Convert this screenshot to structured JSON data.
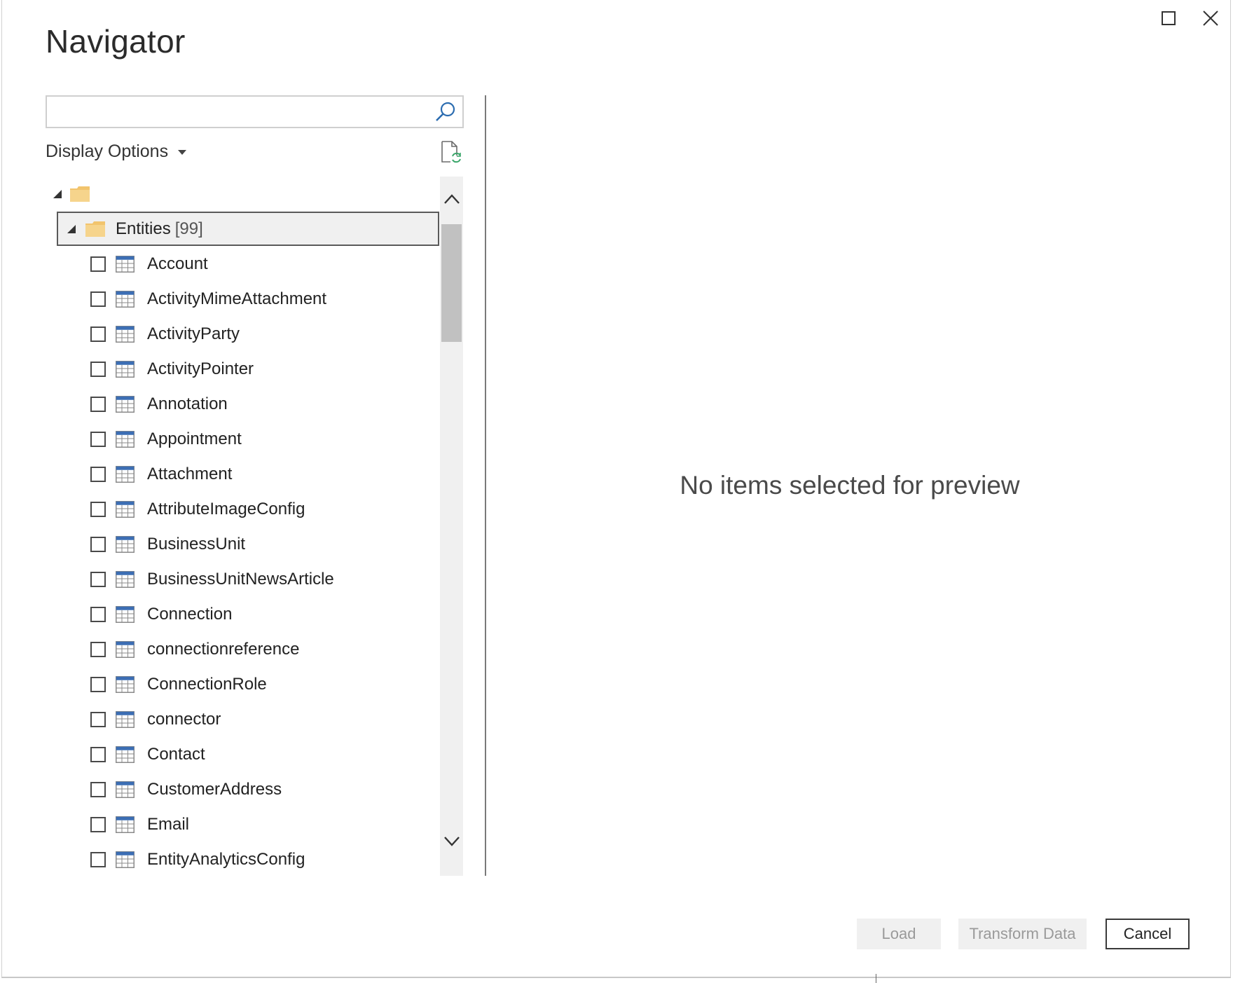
{
  "window": {
    "title": "Navigator",
    "maximize_icon": "maximize-icon",
    "close_icon": "close-icon"
  },
  "search": {
    "value": "",
    "placeholder": "",
    "icon": "search-icon"
  },
  "display_options": {
    "label": "Display Options",
    "icon": "chevron-down-icon"
  },
  "refresh_icon": "refresh-icon",
  "tree": {
    "root_icon": "folder-icon",
    "entities": {
      "label": "Entities",
      "count": "[99]",
      "icon": "folder-icon"
    },
    "items": [
      "Account",
      "ActivityMimeAttachment",
      "ActivityParty",
      "ActivityPointer",
      "Annotation",
      "Appointment",
      "Attachment",
      "AttributeImageConfig",
      "BusinessUnit",
      "BusinessUnitNewsArticle",
      "Connection",
      "connectionreference",
      "ConnectionRole",
      "connector",
      "Contact",
      "CustomerAddress",
      "Email",
      "EntityAnalyticsConfig"
    ]
  },
  "preview": {
    "message": "No items selected for preview"
  },
  "buttons": {
    "load": "Load",
    "transform": "Transform Data",
    "cancel": "Cancel"
  },
  "colors": {
    "folder": "#f2c46d",
    "table_header": "#3c6eb4",
    "divider": "#7a7a7a",
    "scrollbar_track": "#f0f0f0",
    "scrollbar_thumb": "#c1c1c1",
    "disabled_button": "#f0f0f0"
  }
}
